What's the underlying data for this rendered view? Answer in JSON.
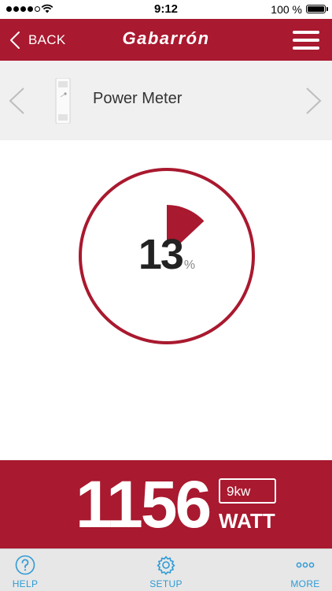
{
  "status_bar": {
    "time": "9:12",
    "battery_percent": "100 %"
  },
  "nav": {
    "back_label": "BACK",
    "brand": "Gabarrón"
  },
  "device": {
    "name": "Power Meter"
  },
  "gauge": {
    "value": "13",
    "unit": "%",
    "fraction": 0.13
  },
  "power": {
    "value": "1156",
    "capacity": "9kw",
    "unit": "WATT"
  },
  "tabs": [
    {
      "label": "HELP",
      "icon": "help-icon"
    },
    {
      "label": "SETUP",
      "icon": "gear-icon"
    },
    {
      "label": "MORE",
      "icon": "more-icon"
    }
  ],
  "colors": {
    "brand_red": "#a9192f",
    "tab_blue": "#2e9bd6"
  }
}
